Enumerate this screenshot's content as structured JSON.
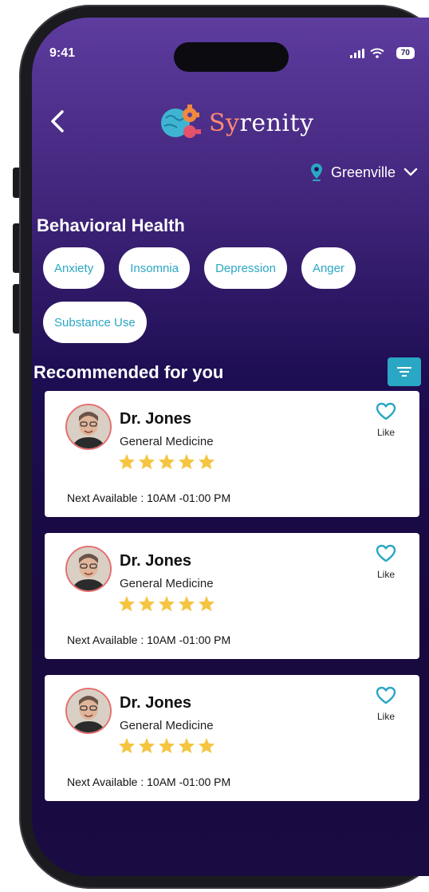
{
  "status": {
    "time": "9:41",
    "battery": "70"
  },
  "header": {
    "logo_first": "Sy",
    "logo_rest": "renity"
  },
  "location": {
    "city": "Greenville"
  },
  "behavioral": {
    "title": "Behavioral Health",
    "chips": [
      "Anxiety",
      "Insomnia",
      "Depression",
      "Anger",
      "Substance Use"
    ]
  },
  "recommended": {
    "title": "Recommended for you",
    "cards": [
      {
        "name": "Dr. Jones",
        "specialty": "General Medicine",
        "rating": 5,
        "next": "Next Available : 10AM -01:00 PM",
        "like": "Like"
      },
      {
        "name": "Dr. Jones",
        "specialty": "General Medicine",
        "rating": 5,
        "next": "Next Available : 10AM -01:00 PM",
        "like": "Like"
      },
      {
        "name": "Dr. Jones",
        "specialty": "General Medicine",
        "rating": 5,
        "next": "Next Available : 10AM -01:00 PM",
        "like": "Like"
      }
    ]
  },
  "colors": {
    "accent": "#2aa7c4",
    "star": "#f5c542",
    "logo": "#ff8a70"
  }
}
